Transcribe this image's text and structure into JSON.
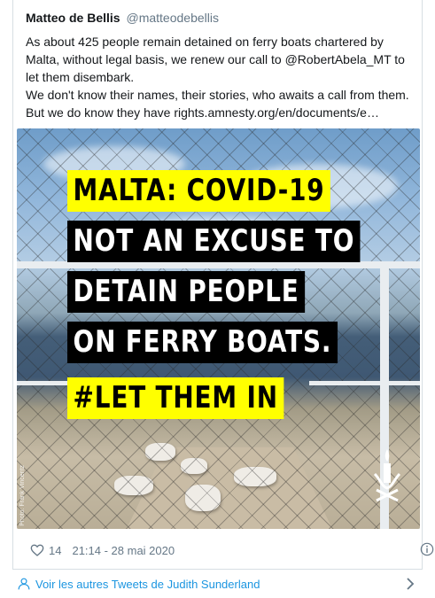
{
  "tweet": {
    "author_name": "Matteo de Bellis",
    "author_handle": "@matteodebellis",
    "text_lines": [
      "As about 425 people remain detained on ferry boats chartered by",
      "Malta, without legal basis, we renew our call to @RobertAbela_MT to",
      "let them disembark.",
      "We don't know their names, their stories, who awaits a call from them.",
      "But we do know they have rights.amnesty.org/en/documents/e…"
    ]
  },
  "media": {
    "headline_lines": [
      {
        "text": "MALTA: COVID-19",
        "style": "yellow"
      },
      {
        "text": "NOT AN EXCUSE TO",
        "style": "black"
      },
      {
        "text": "DETAIN PEOPLE",
        "style": "black"
      },
      {
        "text": "ON FERRY BOATS.",
        "style": "black"
      },
      {
        "text": "#LET THEM IN",
        "style": "yellow"
      }
    ],
    "photo_credit": "Photo: Frank Vincentz",
    "logo": "amnesty-candle-logo"
  },
  "meta": {
    "likes": "14",
    "timestamp": "21:14 - 28 mai 2020",
    "icons": [
      "heart-icon",
      "info-icon"
    ]
  },
  "footer": {
    "link_text": "Voir les autres Tweets de Judith Sunderland",
    "icons": [
      "person-icon",
      "chevron-right-icon"
    ]
  },
  "colors": {
    "text": "#14171a",
    "muted": "#657786",
    "link": "#1b95e0",
    "border": "#d7dee3",
    "highlight_yellow": "#ffff00"
  }
}
